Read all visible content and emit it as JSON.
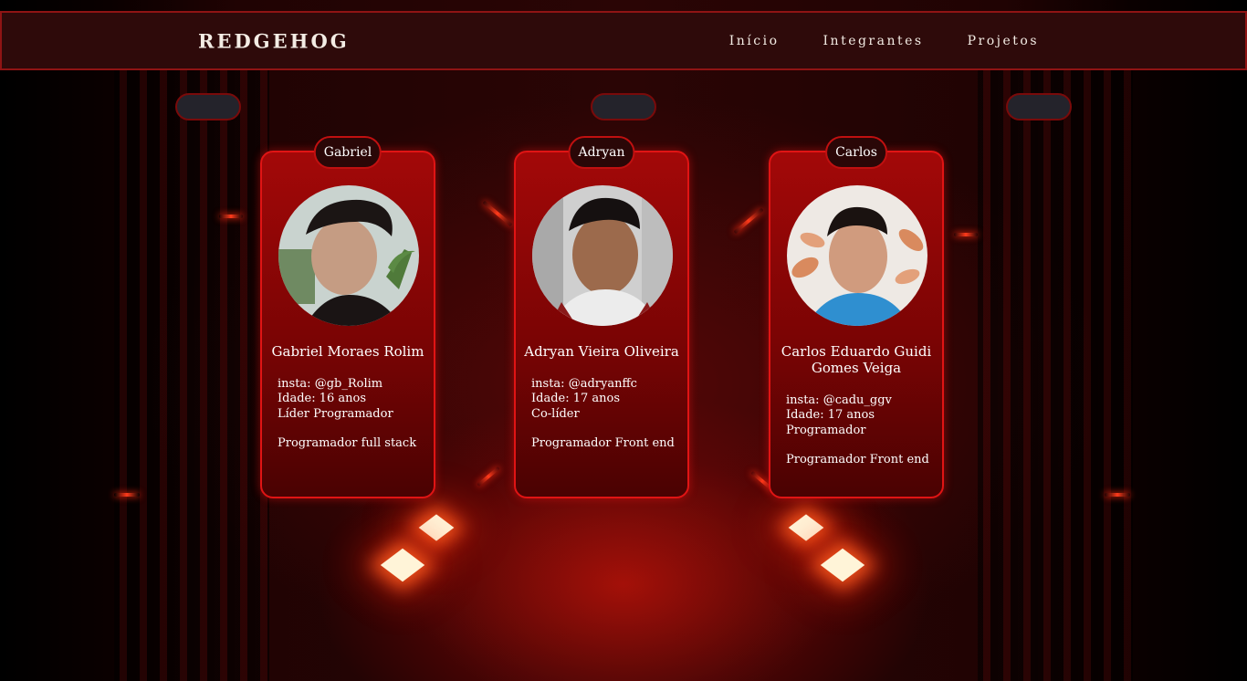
{
  "navbar": {
    "brand": "REDGEHOG",
    "links": [
      "Início",
      "Integrantes",
      "Projetos"
    ]
  },
  "members": [
    {
      "tab": "Gabriel",
      "name": "Gabriel Moraes Rolim",
      "insta": "insta: @gb_Rolim",
      "age": "Idade: 16 anos",
      "role": "Líder Programador",
      "specialty": "Programador full stack"
    },
    {
      "tab": "Adryan",
      "name": "Adryan Vieira Oliveira",
      "insta": "insta: @adryanffc",
      "age": "Idade: 17 anos",
      "role": "Co-líder",
      "specialty": "Programador Front end"
    },
    {
      "tab": "Carlos",
      "name": "Carlos Eduardo Guidi Gomes Veiga",
      "insta": "insta: @cadu_ggv",
      "age": "Idade: 17 anos",
      "role": "Programador",
      "specialty": "Programador Front end"
    }
  ],
  "colors": {
    "navbar_bg": "#2e0a0a",
    "accent": "#e01414",
    "card_top": "#a30808",
    "card_bottom": "#4a0202"
  }
}
